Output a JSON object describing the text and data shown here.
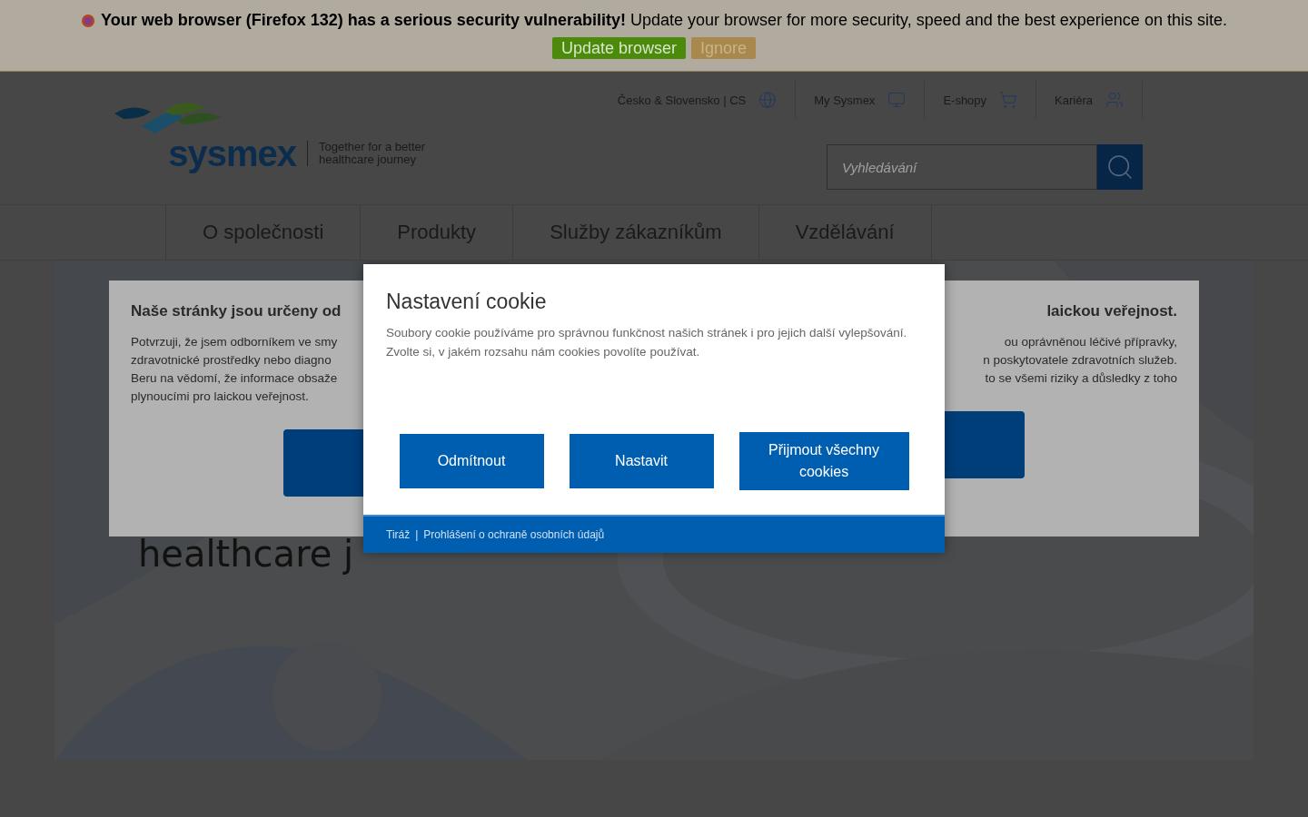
{
  "banner": {
    "message": "**Your web browser (Firefox 132) has a serious security vulnerability!** Update your browser for more security, speed and the best experience on this site.",
    "buttons": [
      {
        "label": "Update browser",
        "kind": "primary"
      },
      {
        "label": "Ignore",
        "kind": "secondary"
      }
    ]
  },
  "header": {
    "logo": {
      "wordmark": "sysmex",
      "tagline": "Together for a better healthcare journey"
    },
    "top_links": [
      "Česko & Slovensko | CS",
      "My Sysmex",
      "E-shopy",
      "Kariéra"
    ],
    "search": {
      "placeholder": "Vyhledávání"
    }
  },
  "nav": [
    "O společnosti",
    "Produkty",
    "Služby zákazníkům",
    "Vzdělávání"
  ],
  "hero": {
    "title": "healthcare j"
  },
  "audience_dialog": {
    "title_left": "Naše stránky jsou určeny od",
    "title_right": "laickou veřejnost.",
    "body_left": [
      "Potvrzuji, že jsem odborníkem ve smy",
      "zdravotnické prostředky nebo diagno",
      "Beru na vědomí, že informace obsaže",
      "plynoucími pro laickou veřejnost."
    ],
    "body_right": [
      "ou oprávněnou léčivé přípravky,",
      "n poskytovatele zdravotních služeb.",
      "to se všemi riziky a důsledky z toho"
    ]
  },
  "cookie_modal": {
    "title": "Nastavení cookie",
    "text": "Soubory cookie používáme pro správnou funkčnost našich stránek i pro jejich další vylepšování. Zvolte si, v jakém rozsahu nám cookies povolíte používat.",
    "buttons": [
      "Odmítnout",
      "Nastavit",
      "Přijmout všechny cookies"
    ],
    "footer_links": [
      "Tiráž",
      "Prohlášení o ochraně osobních údajů"
    ],
    "separator": "|"
  }
}
